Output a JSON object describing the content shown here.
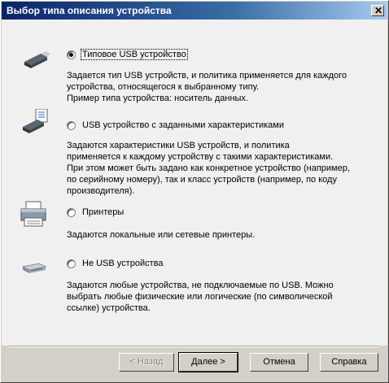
{
  "window": {
    "title": "Выбор типа описания устройства"
  },
  "options": [
    {
      "label": "Типовое USB устройство",
      "icon": "usb-drive-icon",
      "checked": true,
      "description": [
        "Задается тип USB устройств, и политика применяется для каждого",
        "устройства, относящегося к выбранному типу.",
        "Пример типа устройства: носитель данных."
      ]
    },
    {
      "label": "USB устройство с заданными характеристиками",
      "icon": "usb-drive-document-icon",
      "checked": false,
      "description": [
        "Задаются характеристики USB устройств, и политика",
        "применяется к каждому устройству с такими характеристиками.",
        "При этом может быть задано как конкретное устройство (например,",
        "по серийному номеру), так и класс устройств (например, по коду",
        "производителя)."
      ]
    },
    {
      "label": "Принтеры",
      "icon": "printer-icon",
      "checked": false,
      "description": [
        "Задаются локальные или сетевые принтеры."
      ]
    },
    {
      "label": "Не USB устройства",
      "icon": "device-icon",
      "checked": false,
      "description": [
        "Задаются любые устройства, не подключаемые по USB. Можно",
        "выбрать любые физические или логические (по символической",
        "ссылке) устройства."
      ]
    }
  ],
  "buttons": {
    "back": "< Назад",
    "next": "Далее >",
    "cancel": "Отмена",
    "help": "Справка"
  }
}
